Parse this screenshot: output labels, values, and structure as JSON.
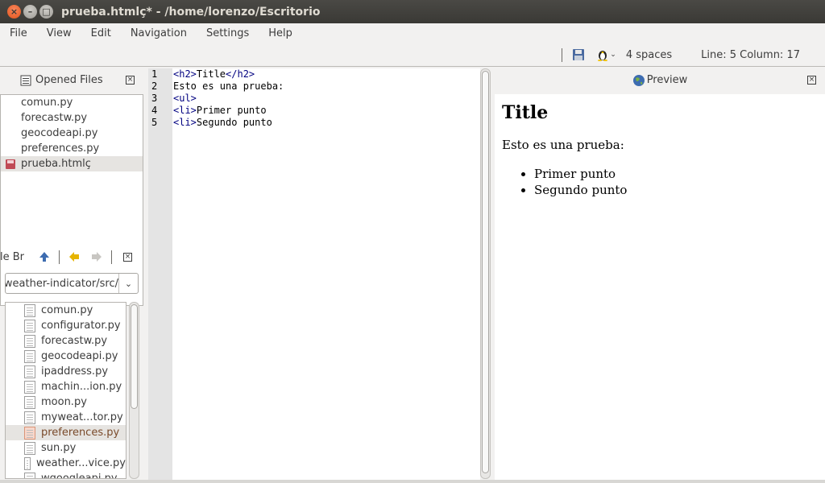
{
  "window": {
    "title": "prueba.htmlç* - /home/lorenzo/Escritorio",
    "buttons": {
      "close": "×",
      "minimize": "–",
      "maximize": "□"
    }
  },
  "menu": [
    "File",
    "View",
    "Edit",
    "Navigation",
    "Settings",
    "Help"
  ],
  "status": {
    "indent": "4 spaces",
    "position": "Line: 5 Column: 17",
    "icons": [
      "save-icon",
      "linux-icon"
    ]
  },
  "opened_files": {
    "title": "Opened Files",
    "items": [
      "comun.py",
      "forecastw.py",
      "geocodeapi.py",
      "preferences.py",
      "prueba.htmlç"
    ],
    "selected": "prueba.htmlç"
  },
  "file_browser": {
    "title": "le Br",
    "path": "/weather-indicator/src",
    "files": [
      "comun.py",
      "configurator.py",
      "forecastw.py",
      "geocodeapi.py",
      "ipaddress.py",
      "machin...ion.py",
      "moon.py",
      "myweat...tor.py",
      "preferences.py",
      "sun.py",
      "weather...vice.py",
      "wgoogleapi.py"
    ],
    "selected": "preferences.py"
  },
  "editor": {
    "line_numbers": [
      "1",
      "2",
      "3",
      "4",
      "5"
    ],
    "lines": [
      {
        "parts": [
          {
            "t": "<h2>",
            "tag": true
          },
          {
            "t": "Title"
          },
          {
            "t": "</h2>",
            "tag": true
          }
        ]
      },
      {
        "parts": [
          {
            "t": "Esto es una prueba:"
          }
        ]
      },
      {
        "parts": [
          {
            "t": "<ul>",
            "tag": true
          }
        ]
      },
      {
        "parts": [
          {
            "t": "<li>",
            "tag": true
          },
          {
            "t": "Primer punto"
          }
        ]
      },
      {
        "parts": [
          {
            "t": "<li>",
            "tag": true
          },
          {
            "t": "Segundo punto"
          }
        ]
      }
    ]
  },
  "preview": {
    "title": "Preview",
    "heading": "Title",
    "paragraph": "Esto es una prueba:",
    "items": [
      "Primer punto",
      "Segundo punto"
    ]
  }
}
